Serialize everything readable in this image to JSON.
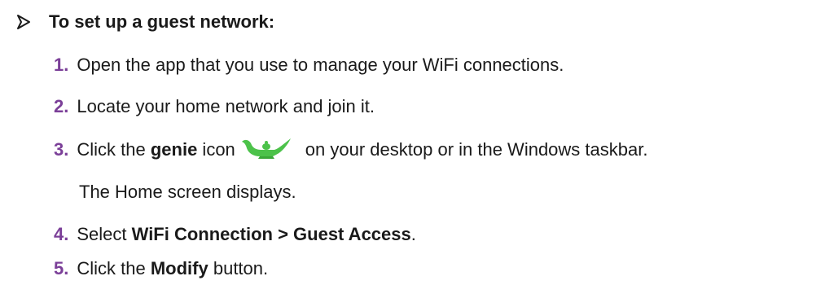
{
  "heading": {
    "icon": "arrow-right-icon",
    "text": "To set up a guest network:"
  },
  "steps": [
    {
      "num": "1.",
      "parts": [
        "Open the app that you use to manage your WiFi connections."
      ]
    },
    {
      "num": "2.",
      "parts": [
        "Locate your home network and join it."
      ]
    },
    {
      "num": "3.",
      "pre": "Click the ",
      "bold": "genie",
      "mid": " icon",
      "icon": "genie-lamp-icon",
      "post": "on your desktop or in the Windows taskbar."
    },
    {
      "num": "4.",
      "pre": "Select ",
      "bold": "WiFi Connection > Guest Access",
      "post": "."
    },
    {
      "num": "5.",
      "pre": "Click the ",
      "bold": "Modify",
      "post": " button."
    }
  ],
  "note": "The Home screen displays.",
  "colors": {
    "step_number": "#7b3f98",
    "genie_icon": "#4cc24a"
  }
}
